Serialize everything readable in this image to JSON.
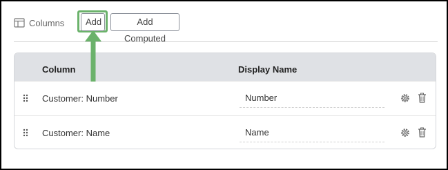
{
  "toolbar": {
    "columns_label": "Columns",
    "add_label": "Add",
    "add_computed_label": "Add Computed"
  },
  "table": {
    "headers": [
      "Column",
      "Display Name"
    ],
    "rows": [
      {
        "column": "Customer: Number",
        "display_name": "Number"
      },
      {
        "column": "Customer: Name",
        "display_name": "Name"
      }
    ]
  },
  "icons": {
    "columns": "table-columns-icon",
    "drag": "drag-handle-icon",
    "settings": "gear-icon",
    "delete": "trash-icon",
    "callout": "up-arrow-icon"
  },
  "colors": {
    "highlight": "#6bb26b",
    "header_bg": "#dfe1e5"
  }
}
